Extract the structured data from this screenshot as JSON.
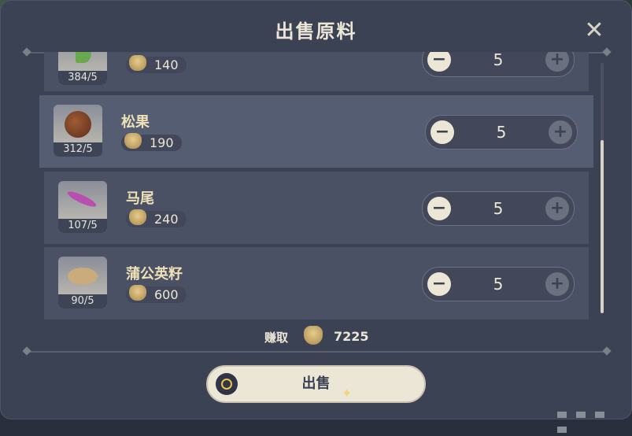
{
  "dialog": {
    "title": "出售原料",
    "close_icon": "close-icon"
  },
  "items": [
    {
      "name": "",
      "count": "384/5",
      "price": "140",
      "qty": "5",
      "icon": "green-leaf-icon",
      "selected": false
    },
    {
      "name": "松果",
      "count": "312/5",
      "price": "190",
      "qty": "5",
      "icon": "pinecone-icon",
      "selected": true
    },
    {
      "name": "马尾",
      "count": "107/5",
      "price": "240",
      "qty": "5",
      "icon": "horsetail-icon",
      "selected": false
    },
    {
      "name": "蒲公英籽",
      "count": "90/5",
      "price": "600",
      "qty": "5",
      "icon": "dandelion-seed-icon",
      "selected": false
    }
  ],
  "summary": {
    "earn_label": "赚取",
    "earn_value": "7225"
  },
  "actions": {
    "sell_label": "出售"
  },
  "colors": {
    "panel": "#3b4254",
    "row": "#4a5164",
    "row_selected": "#555d72",
    "accent_text": "#ece0b6"
  }
}
